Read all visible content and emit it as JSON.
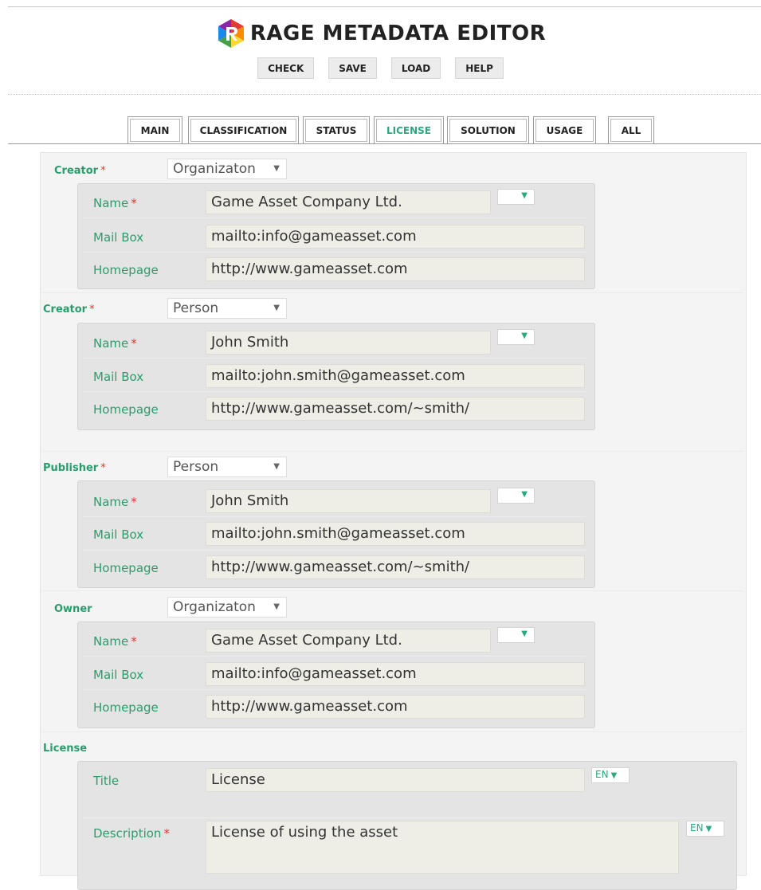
{
  "app": {
    "title": "RAGE METADATA EDITOR"
  },
  "toolbar": [
    {
      "label": "CHECK"
    },
    {
      "label": "SAVE"
    },
    {
      "label": "LOAD"
    },
    {
      "label": "HELP"
    }
  ],
  "tabs": [
    {
      "label": "MAIN",
      "active": false
    },
    {
      "label": "CLASSIFICATION",
      "active": false
    },
    {
      "label": "STATUS",
      "active": false
    },
    {
      "label": "LICENSE",
      "active": true
    },
    {
      "label": "SOLUTION",
      "active": false
    },
    {
      "label": "USAGE",
      "active": false
    },
    {
      "label": "ALL",
      "active": false
    }
  ],
  "sections": [
    {
      "label": "Creator",
      "required": true,
      "type": "Organizaton",
      "fields": {
        "name_label": "Name",
        "name": "Game Asset Company Ltd.",
        "mail_label": "Mail Box",
        "mail": "mailto:info@gameasset.com",
        "home_label": "Homepage",
        "home": "http://www.gameasset.com"
      }
    },
    {
      "label": "Creator",
      "required": true,
      "type": "Person",
      "fields": {
        "name_label": "Name",
        "name": "John Smith",
        "mail_label": "Mail Box",
        "mail": "mailto:john.smith@gameasset.com",
        "home_label": "Homepage",
        "home": "http://www.gameasset.com/~smith/"
      }
    },
    {
      "label": "Publisher",
      "required": true,
      "type": "Person",
      "fields": {
        "name_label": "Name",
        "name": "John Smith",
        "mail_label": "Mail Box",
        "mail": "mailto:john.smith@gameasset.com",
        "home_label": "Homepage",
        "home": "http://www.gameasset.com/~smith/"
      }
    },
    {
      "label": "Owner",
      "required": false,
      "type": "Organizaton",
      "fields": {
        "name_label": "Name",
        "name": "Game Asset Company Ltd.",
        "mail_label": "Mail Box",
        "mail": "mailto:info@gameasset.com",
        "home_label": "Homepage",
        "home": "http://www.gameasset.com"
      }
    }
  ],
  "license": {
    "label": "License",
    "title_label": "Title",
    "title": "License",
    "title_lang": "EN",
    "desc_label": "Description",
    "description": "License of using the asset",
    "desc_lang": "EN"
  },
  "colors": {
    "accent": "#2a9d6c",
    "required": "#e33333"
  }
}
